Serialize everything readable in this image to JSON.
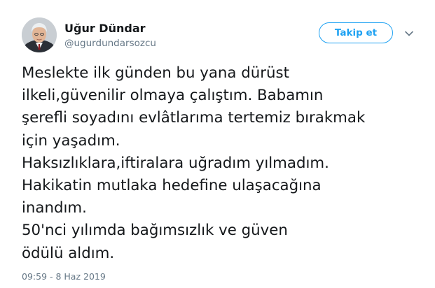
{
  "user": {
    "display_name": "Uğur Dündar",
    "handle": "@ugurdundarsozcu"
  },
  "follow_button": {
    "label": "Takip et"
  },
  "icons": {
    "menu": "chevron-down-icon",
    "avatar": "profile-photo"
  },
  "colors": {
    "accent": "#1da1f2",
    "text": "#14171a",
    "secondary_text": "#657786"
  },
  "tweet": {
    "lines": [
      "Meslekte ilk günden bu yana dürüst",
      "ilkeli,güvenilir olmaya çalıştım. Babamın",
      "şerefli soyadını evlâtlarıma tertemiz bırakmak",
      "için yaşadım.",
      "Haksızlıklara,iftiralara uğradım yılmadım.",
      "Hakikatin mutlaka hedefine ulaşacağına",
      "inandım.",
      "50'nci yılımda bağımsızlık ve güven",
      "ödülü aldım."
    ],
    "timestamp": "09:59 - 8 Haz 2019"
  }
}
